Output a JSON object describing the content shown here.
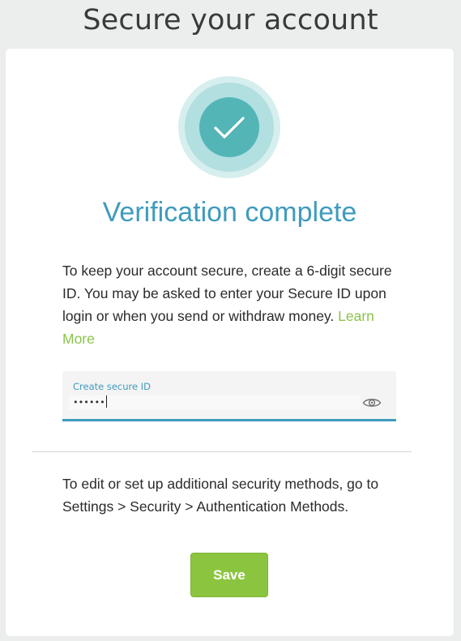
{
  "page": {
    "title": "Secure your account"
  },
  "status": {
    "icon": "checkmark-icon",
    "headline": "Verification complete"
  },
  "intro": {
    "text": "To keep your account secure, create a 6-digit secure ID. You may be asked to enter your Secure ID upon login or when you send or withdraw money. ",
    "link_label": "Learn More"
  },
  "secure_id_field": {
    "label": "Create secure ID",
    "masked_value": "••••••",
    "toggle_icon": "eye-icon"
  },
  "settings": {
    "text": "To edit or set up additional security methods, go to Settings > Security > Authentication Methods."
  },
  "actions": {
    "save_label": "Save"
  },
  "colors": {
    "accent_teal": "#3e9bbd",
    "badge_teal": "#54b5b7",
    "success_green": "#8bc53f",
    "link_green": "#8bc34a"
  }
}
